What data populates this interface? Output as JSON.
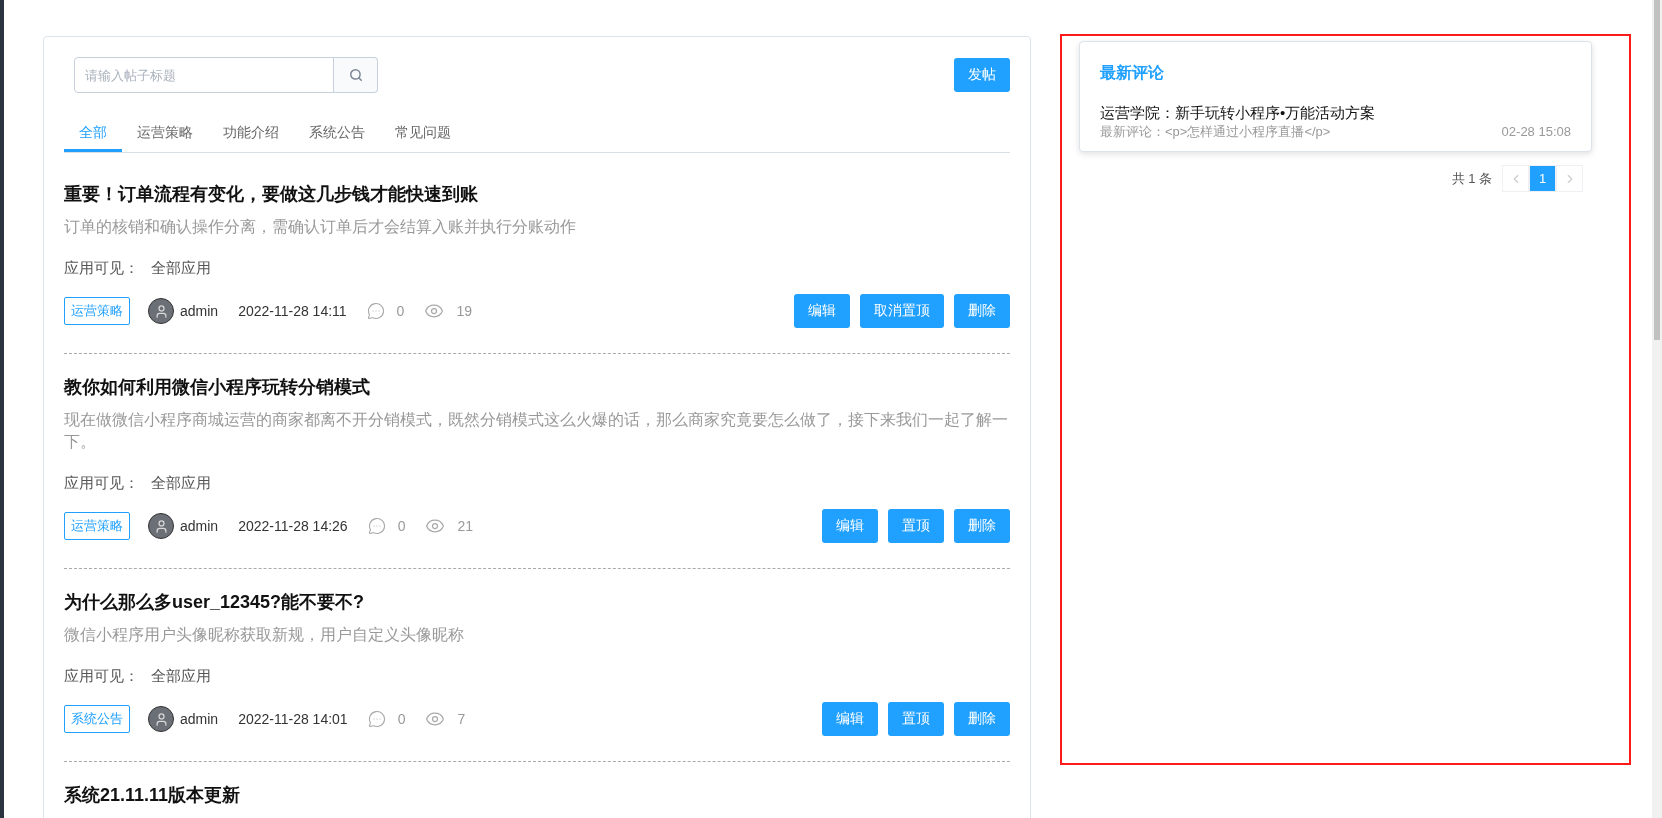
{
  "search": {
    "placeholder": "请输入帖子标题"
  },
  "post_button": "发帖",
  "tabs": [
    {
      "label": "全部",
      "selected": true
    },
    {
      "label": "运营策略",
      "selected": false
    },
    {
      "label": "功能介绍",
      "selected": false
    },
    {
      "label": "系统公告",
      "selected": false
    },
    {
      "label": "常见问题",
      "selected": false
    }
  ],
  "posts": [
    {
      "title": "重要！订单流程有变化，要做这几步钱才能快速到账",
      "summary": "订单的核销和确认操作分离，需确认订单后才会结算入账并执行分账动作",
      "visibility_label": "应用可见：",
      "visibility_value": "全部应用",
      "tag": "运营策略",
      "author": "admin",
      "time": "2022-11-28 14:11",
      "comments": "0",
      "views": "19",
      "actions": [
        "编辑",
        "取消置顶",
        "删除"
      ]
    },
    {
      "title": "教你如何利用微信小程序玩转分销模式",
      "summary": "现在做微信小程序商城运营的商家都离不开分销模式，既然分销模式这么火爆的话，那么商家究竟要怎么做了，接下来我们一起了解一下。",
      "visibility_label": "应用可见：",
      "visibility_value": "全部应用",
      "tag": "运营策略",
      "author": "admin",
      "time": "2022-11-28 14:26",
      "comments": "0",
      "views": "21",
      "actions": [
        "编辑",
        "置顶",
        "删除"
      ]
    },
    {
      "title": "为什么那么多user_12345?能不要不?",
      "summary": "微信小程序用户头像昵称获取新规，用户自定义头像昵称",
      "visibility_label": "应用可见：",
      "visibility_value": "全部应用",
      "tag": "系统公告",
      "author": "admin",
      "time": "2022-11-28 14:01",
      "comments": "0",
      "views": "7",
      "actions": [
        "编辑",
        "置顶",
        "删除"
      ]
    },
    {
      "title": "系统21.11.11版本更新"
    }
  ],
  "latest_comments": {
    "title": "最新评论",
    "items": [
      {
        "title": "运营学院：新手玩转小程序•万能活动方案",
        "comment": "最新评论：<p>怎样通过小程序直播</p>",
        "time": "02-28 15:08"
      }
    ]
  },
  "pagination": {
    "total": "共 1 条",
    "pages": [
      {
        "label": "1",
        "selected": true
      }
    ]
  }
}
